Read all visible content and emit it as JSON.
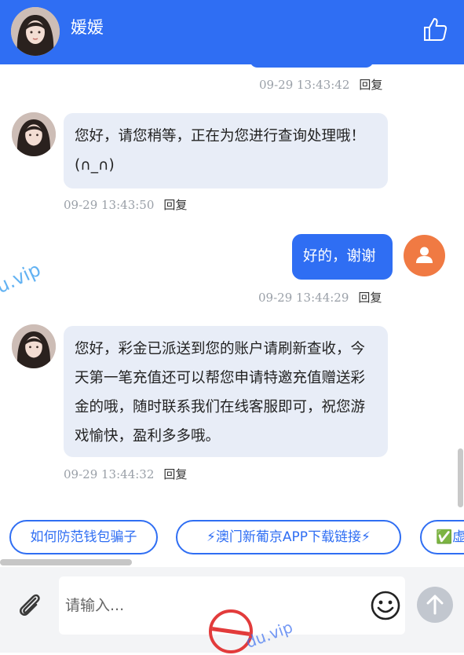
{
  "header": {
    "title": "媛媛",
    "avatar_icon": "girl-avatar",
    "like_icon": "thumbs-up-icon"
  },
  "messages": [
    {
      "direction": "out",
      "time": "09-29 13:43:42",
      "reply": "回复"
    },
    {
      "direction": "in",
      "text": "您好，请您稍等，正在为您进行查询处理哦！(∩_∩)",
      "time": "09-29 13:43:50",
      "reply": "回复"
    },
    {
      "direction": "out",
      "text": "好的，谢谢",
      "time": "09-29 13:44:29",
      "reply": "回复"
    },
    {
      "direction": "in",
      "text": "您好，彩金已派送到您的账户请刷新查收，今天第一笔充值还可以帮您申请特邀充值赠送彩金的哦，随时联系我们在线客服即可，祝您游戏愉快，盈利多多哦。",
      "time": "09-29 13:44:32",
      "reply": "回复"
    }
  ],
  "quick_replies": [
    {
      "label": "如何防范钱包骗子"
    },
    {
      "label": "⚡澳门新葡京APP下载链接⚡"
    },
    {
      "label": "✅虚"
    }
  ],
  "input": {
    "placeholder": "请输入..."
  },
  "icons": {
    "attach": "paperclip-icon",
    "emoji": "smiley-icon",
    "send": "arrow-up-icon"
  },
  "watermarks": [
    "jiedu.vip",
    "u.vip",
    "du.vip"
  ],
  "colors": {
    "brand_blue": "#2f6ef3",
    "incoming_bubble": "#e8edf7",
    "user_avatar": "#f07a43",
    "send_button": "#c2c7cf"
  }
}
